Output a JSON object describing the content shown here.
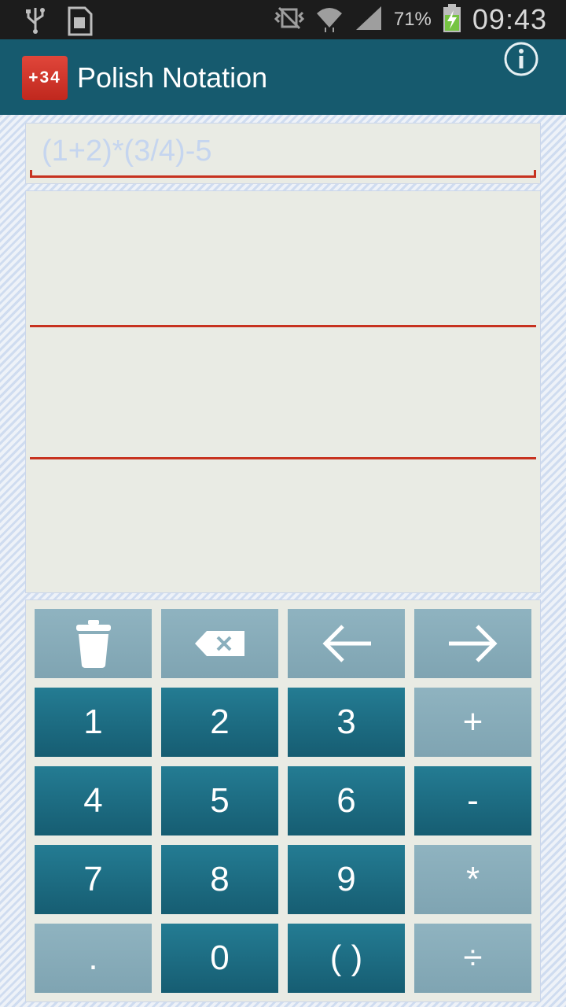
{
  "status_bar": {
    "battery_percent": "71%",
    "time": "09:43",
    "icons": [
      "usb-icon",
      "sim-card-icon",
      "vibrate-off-icon",
      "wifi-icon",
      "signal-icon",
      "battery-charging-icon"
    ]
  },
  "action_bar": {
    "app_icon_text": "+34",
    "title": "Polish Notation",
    "info_icon": "info-icon"
  },
  "expression": {
    "placeholder": "(1+2)*(3/4)-5",
    "value": ""
  },
  "keypad": {
    "rows": [
      [
        {
          "label": "",
          "icon": "trash-icon"
        },
        {
          "label": "",
          "icon": "backspace-icon"
        },
        {
          "label": "",
          "icon": "arrow-left-icon"
        },
        {
          "label": "",
          "icon": "arrow-right-icon"
        }
      ],
      [
        {
          "label": "1"
        },
        {
          "label": "2"
        },
        {
          "label": "3"
        },
        {
          "label": "+"
        }
      ],
      [
        {
          "label": "4"
        },
        {
          "label": "5"
        },
        {
          "label": "6"
        },
        {
          "label": "-"
        }
      ],
      [
        {
          "label": "7"
        },
        {
          "label": "8"
        },
        {
          "label": "9"
        },
        {
          "label": "*"
        }
      ],
      [
        {
          "label": "."
        },
        {
          "label": "0"
        },
        {
          "label": "( )"
        },
        {
          "label": "÷"
        }
      ]
    ]
  },
  "colors": {
    "action_bar": "#165a6e",
    "accent_line": "#c7321f",
    "digit_key": "#1e6f85",
    "operator_key": "#88adba"
  }
}
